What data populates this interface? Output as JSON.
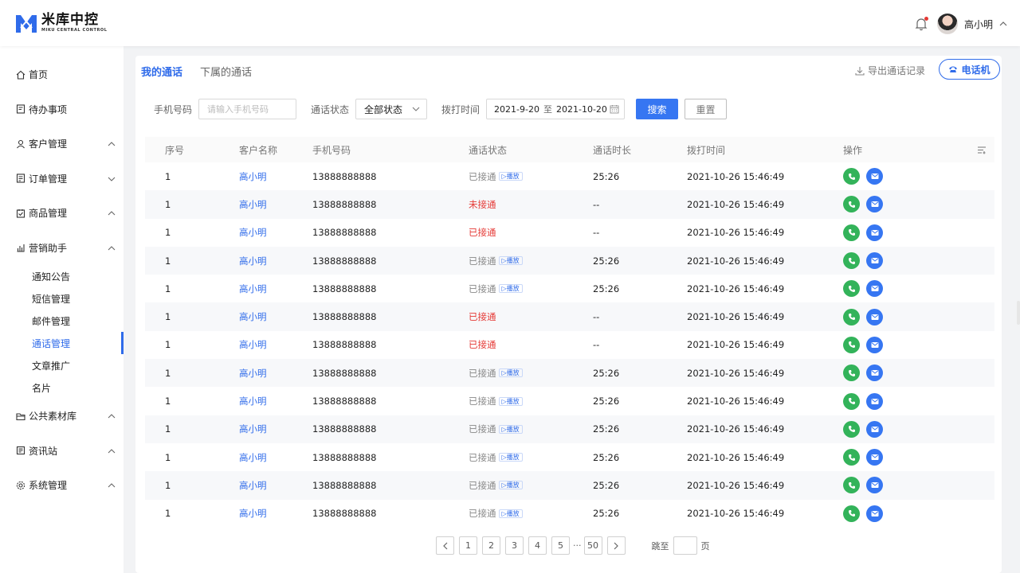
{
  "brand": {
    "name": "米库中控",
    "sub": "MIKU CENTRAL CONTROL",
    "color": "#2f6bea"
  },
  "header": {
    "username": "高小明"
  },
  "sidebar": {
    "items": [
      {
        "label": "首页",
        "icon": "home-icon"
      },
      {
        "label": "待办事项",
        "icon": "todo-icon"
      },
      {
        "label": "客户管理",
        "icon": "customer-icon",
        "arrow": "up"
      },
      {
        "label": "订单管理",
        "icon": "order-icon",
        "arrow": "down"
      },
      {
        "label": "商品管理",
        "icon": "goods-icon",
        "arrow": "up"
      },
      {
        "label": "营销助手",
        "icon": "marketing-icon",
        "arrow": "up"
      }
    ],
    "sub_items": [
      "通知公告",
      "短信管理",
      "邮件管理",
      "通话管理",
      "文章推广",
      "名片"
    ],
    "active_sub": "通话管理",
    "bottom_items": [
      {
        "label": "公共素材库",
        "icon": "library-icon",
        "arrow": "up"
      },
      {
        "label": "资讯站",
        "icon": "news-icon",
        "arrow": "up"
      },
      {
        "label": "系统管理",
        "icon": "settings-icon",
        "arrow": "up"
      }
    ]
  },
  "tabs": [
    {
      "label": "我的通话",
      "active": true
    },
    {
      "label": "下属的通话",
      "active": false
    }
  ],
  "toolbar": {
    "export_label": "导出通话记录",
    "phone_label": "电话机"
  },
  "filters": {
    "phone_label": "手机号码",
    "phone_placeholder": "请输入手机号码",
    "status_label": "通话状态",
    "status_value": "全部状态",
    "time_label": "拨打时间",
    "date_from": "2021-9-20",
    "date_sep": "至",
    "date_to": "2021-10-20",
    "search_label": "搜索",
    "reset_label": "重置"
  },
  "table": {
    "headers": [
      "序号",
      "客户名称",
      "手机号码",
      "通话状态",
      "通话时长",
      "拨打时间",
      "操作"
    ],
    "play_label": "▷播放",
    "rows": [
      {
        "no": "1",
        "name": "高小明",
        "phone": "13888888888",
        "status": "已接通",
        "status_type": "ok",
        "duration": "25:26",
        "time": "2021-10-26 15:46:49"
      },
      {
        "no": "1",
        "name": "高小明",
        "phone": "13888888888",
        "status": "未接通",
        "status_type": "miss",
        "duration": "--",
        "time": "2021-10-26 15:46:49"
      },
      {
        "no": "1",
        "name": "高小明",
        "phone": "13888888888",
        "status": "已接通",
        "status_type": "miss",
        "duration": "--",
        "time": "2021-10-26 15:46:49"
      },
      {
        "no": "1",
        "name": "高小明",
        "phone": "13888888888",
        "status": "已接通",
        "status_type": "ok",
        "duration": "25:26",
        "time": "2021-10-26 15:46:49"
      },
      {
        "no": "1",
        "name": "高小明",
        "phone": "13888888888",
        "status": "已接通",
        "status_type": "ok",
        "duration": "25:26",
        "time": "2021-10-26 15:46:49"
      },
      {
        "no": "1",
        "name": "高小明",
        "phone": "13888888888",
        "status": "已接通",
        "status_type": "miss",
        "duration": "--",
        "time": "2021-10-26 15:46:49"
      },
      {
        "no": "1",
        "name": "高小明",
        "phone": "13888888888",
        "status": "已接通",
        "status_type": "miss",
        "duration": "--",
        "time": "2021-10-26 15:46:49"
      },
      {
        "no": "1",
        "name": "高小明",
        "phone": "13888888888",
        "status": "已接通",
        "status_type": "ok",
        "duration": "25:26",
        "time": "2021-10-26 15:46:49"
      },
      {
        "no": "1",
        "name": "高小明",
        "phone": "13888888888",
        "status": "已接通",
        "status_type": "ok",
        "duration": "25:26",
        "time": "2021-10-26 15:46:49"
      },
      {
        "no": "1",
        "name": "高小明",
        "phone": "13888888888",
        "status": "已接通",
        "status_type": "ok",
        "duration": "25:26",
        "time": "2021-10-26 15:46:49"
      },
      {
        "no": "1",
        "name": "高小明",
        "phone": "13888888888",
        "status": "已接通",
        "status_type": "ok",
        "duration": "25:26",
        "time": "2021-10-26 15:46:49"
      },
      {
        "no": "1",
        "name": "高小明",
        "phone": "13888888888",
        "status": "已接通",
        "status_type": "ok",
        "duration": "25:26",
        "time": "2021-10-26 15:46:49"
      },
      {
        "no": "1",
        "name": "高小明",
        "phone": "13888888888",
        "status": "已接通",
        "status_type": "ok",
        "duration": "25:26",
        "time": "2021-10-26 15:46:49"
      }
    ]
  },
  "pagination": {
    "pages": [
      "1",
      "2",
      "3",
      "4",
      "5"
    ],
    "ellipsis": "···",
    "last": "50",
    "jump_prefix": "跳至",
    "jump_suffix": "页"
  },
  "colors": {
    "primary": "#3676f2",
    "success": "#33b35a",
    "danger": "#e53935"
  }
}
